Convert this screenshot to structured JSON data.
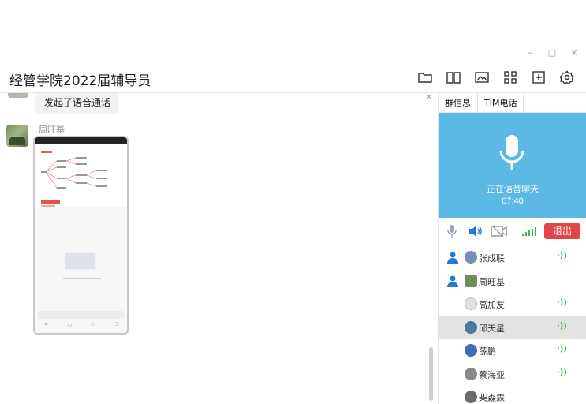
{
  "window": {
    "title": "经管学院2022届辅导员",
    "controls": [
      "–",
      "□",
      "×"
    ]
  },
  "toolbar": {
    "icons": [
      "folder-icon",
      "book-icon",
      "image-icon",
      "apps-icon",
      "add-icon",
      "settings-icon"
    ]
  },
  "chat": {
    "messages": [
      {
        "type": "system",
        "text": "发起了语音通话"
      },
      {
        "type": "image",
        "sender": "周旺基"
      }
    ]
  },
  "panel": {
    "tabs": [
      "群信息",
      "TIM电话"
    ],
    "call": {
      "status": "正在语音聊天",
      "duration": "07:40",
      "exit_label": "退出"
    },
    "members": [
      {
        "name": "张成联",
        "host": true,
        "speaking": true,
        "avatar_color": "#7a8fb5",
        "selected": false
      },
      {
        "name": "周旺基",
        "host": true,
        "speaking": false,
        "avatar_color": "#6f8f59",
        "selected": false
      },
      {
        "name": "高加友",
        "host": false,
        "speaking": true,
        "avatar_color": "#d6d6d6",
        "selected": false
      },
      {
        "name": "邱天星",
        "host": false,
        "speaking": true,
        "avatar_color": "#4a7b9d",
        "selected": true
      },
      {
        "name": "薛鹏",
        "host": false,
        "speaking": true,
        "avatar_color": "#3d6fb3",
        "selected": false
      },
      {
        "name": "蔡海亚",
        "host": false,
        "speaking": true,
        "avatar_color": "#8a8a8a",
        "selected": false
      },
      {
        "name": "柴森霖",
        "host": false,
        "speaking": false,
        "avatar_color": "#6b6b6b",
        "selected": false
      }
    ],
    "speak_glyph": "·))"
  },
  "colors": {
    "call_bg": "#5cb8e5",
    "exit_bg": "#e0454a",
    "host_icon": "#1f7ad8",
    "speaking": "#3cb454"
  }
}
